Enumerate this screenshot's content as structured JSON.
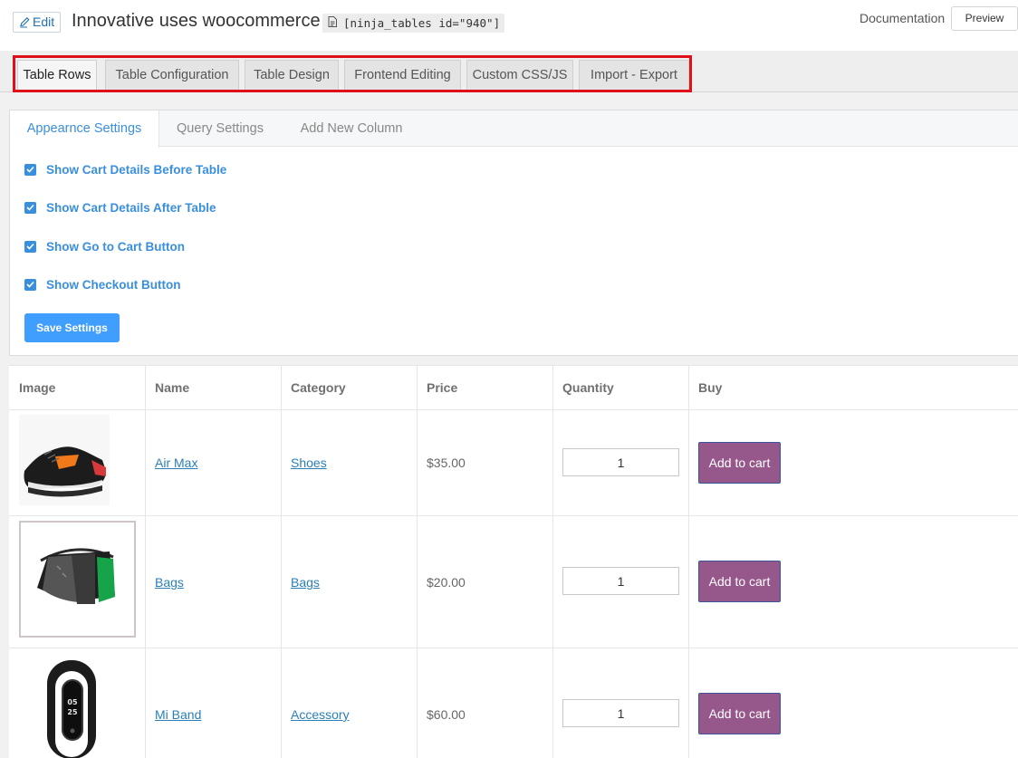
{
  "header": {
    "edit_label": "Edit",
    "title": "Innovative uses woocommerce",
    "shortcode": "[ninja_tables id=\"940\"]",
    "documentation_label": "Documentation",
    "preview_label": "Preview"
  },
  "main_tabs": [
    {
      "label": "Table Rows",
      "active": true
    },
    {
      "label": "Table Configuration",
      "active": false
    },
    {
      "label": "Table Design",
      "active": false
    },
    {
      "label": "Frontend Editing",
      "active": false
    },
    {
      "label": "Custom CSS/JS",
      "active": false
    },
    {
      "label": "Import - Export",
      "active": false
    }
  ],
  "sub_tabs": [
    {
      "label": "Appearnce Settings",
      "active": true
    },
    {
      "label": "Query Settings",
      "active": false
    },
    {
      "label": "Add New Column",
      "active": false
    }
  ],
  "settings": {
    "options": [
      {
        "label": "Show Cart Details Before Table",
        "checked": true
      },
      {
        "label": "Show Cart Details After Table",
        "checked": true
      },
      {
        "label": "Show Go to Cart Button",
        "checked": true
      },
      {
        "label": "Show Checkout Button",
        "checked": true
      }
    ],
    "save_label": "Save Settings"
  },
  "table": {
    "columns": [
      "Image",
      "Name",
      "Category",
      "Price",
      "Quantity",
      "Buy"
    ],
    "rows": [
      {
        "image": "sneaker-image",
        "name": "Air Max",
        "category": "Shoes",
        "price": "$35.00",
        "quantity": "1",
        "buy_label": "Add to cart"
      },
      {
        "image": "bag-image",
        "name": "Bags",
        "category": "Bags",
        "price": "$20.00",
        "quantity": "1",
        "buy_label": "Add to cart"
      },
      {
        "image": "band-image",
        "name": "Mi Band",
        "category": "Accessory",
        "price": "$60.00",
        "quantity": "1",
        "buy_label": "Add to cart"
      }
    ],
    "band_display": {
      "line1": "05",
      "line2": "25"
    }
  },
  "colors": {
    "highlight_border": "#e0101b",
    "accent_blue": "#409eff",
    "add_to_cart_bg": "#96588a",
    "link_blue": "#2b7fb8"
  }
}
